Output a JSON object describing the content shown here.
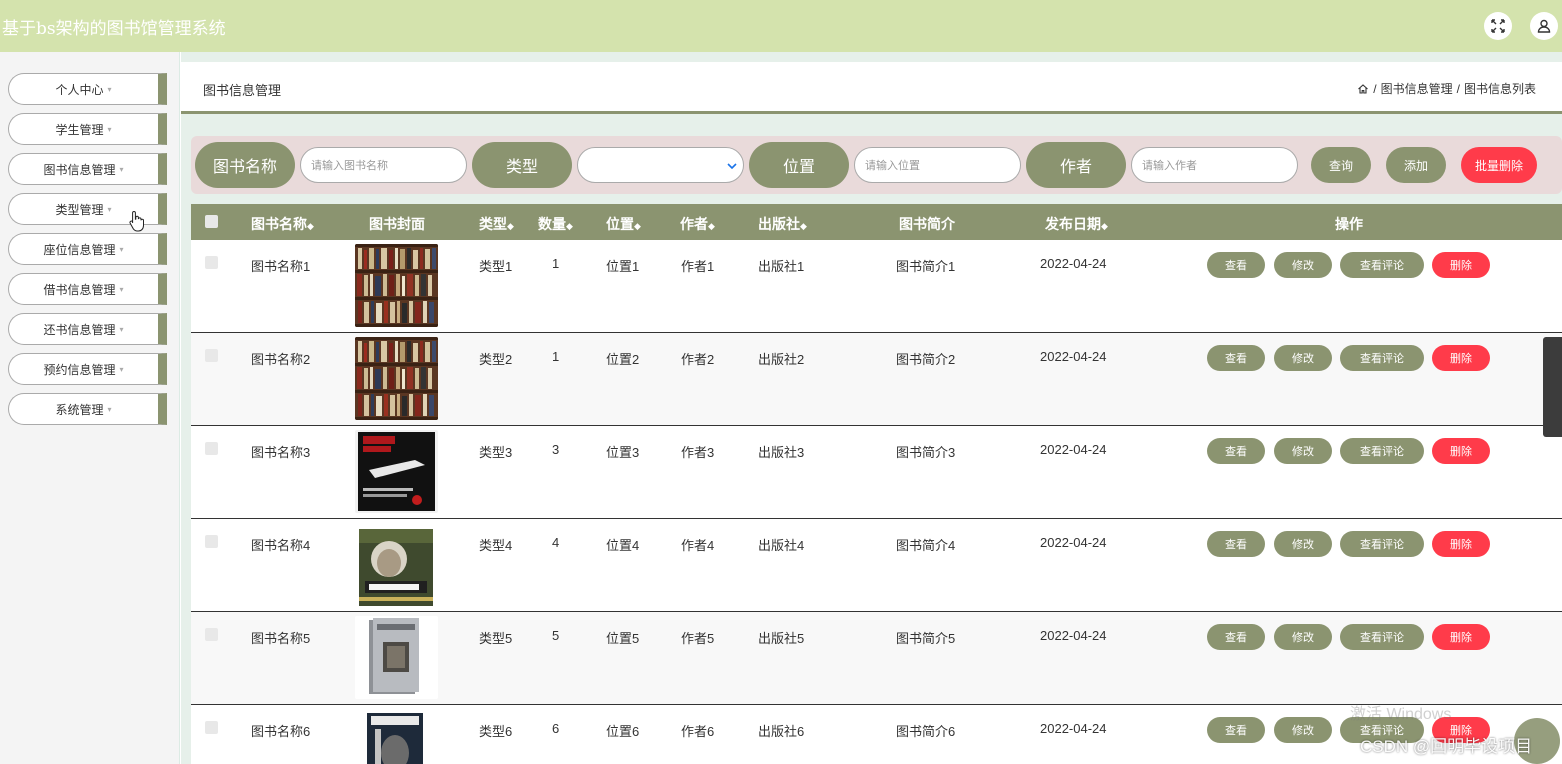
{
  "app": {
    "title": "基于bs架构的图书馆管理系统"
  },
  "header_icons": [
    "fullscreen-icon",
    "user-icon"
  ],
  "sidebar": {
    "items": [
      {
        "label": "个人中心",
        "caret": "▾"
      },
      {
        "label": "学生管理",
        "caret": "▾"
      },
      {
        "label": "图书信息管理",
        "caret": "▾"
      },
      {
        "label": "类型管理",
        "caret": "▾"
      },
      {
        "label": "座位信息管理",
        "caret": "▾"
      },
      {
        "label": "借书信息管理",
        "caret": "▾"
      },
      {
        "label": "还书信息管理",
        "caret": "▾"
      },
      {
        "label": "预约信息管理",
        "caret": "▾"
      },
      {
        "label": "系统管理",
        "caret": "▾"
      }
    ]
  },
  "page": {
    "title": "图书信息管理",
    "breadcrumb": [
      "/",
      "图书信息管理",
      "/",
      "图书信息列表"
    ]
  },
  "search": {
    "name_label": "图书名称",
    "name_placeholder": "请输入图书名称",
    "type_label": "类型",
    "type_value": "",
    "location_label": "位置",
    "location_placeholder": "请输入位置",
    "author_label": "作者",
    "author_placeholder": "请输入作者",
    "query_button": "查询",
    "add_button": "添加",
    "batch_delete_button": "批量删除"
  },
  "table": {
    "sort_glyph": "◆",
    "headers": {
      "name": "图书名称",
      "cover": "图书封面",
      "type": "类型",
      "quantity": "数量",
      "location": "位置",
      "author": "作者",
      "publisher": "出版社",
      "intro": "图书简介",
      "date": "发布日期",
      "actions": "操作"
    },
    "actions": {
      "view": "查看",
      "edit": "修改",
      "comments": "查看评论",
      "delete": "删除"
    },
    "rows": [
      {
        "name": "图书名称1",
        "type": "类型1",
        "quantity": "1",
        "location": "位置1",
        "author": "作者1",
        "publisher": "出版社1",
        "intro": "图书简介1",
        "date": "2022-04-24",
        "cover": "bookshelf"
      },
      {
        "name": "图书名称2",
        "type": "类型2",
        "quantity": "1",
        "location": "位置2",
        "author": "作者2",
        "publisher": "出版社2",
        "intro": "图书简介2",
        "date": "2022-04-24",
        "cover": "bookshelf"
      },
      {
        "name": "图书名称3",
        "type": "类型3",
        "quantity": "3",
        "location": "位置3",
        "author": "作者3",
        "publisher": "出版社3",
        "intro": "图书简介3",
        "date": "2022-04-24",
        "cover": "dark-book"
      },
      {
        "name": "图书名称4",
        "type": "类型4",
        "quantity": "4",
        "location": "位置4",
        "author": "作者4",
        "publisher": "出版社4",
        "intro": "图书简介4",
        "date": "2022-04-24",
        "cover": "portrait-book"
      },
      {
        "name": "图书名称5",
        "type": "类型5",
        "quantity": "5",
        "location": "位置5",
        "author": "作者5",
        "publisher": "出版社5",
        "intro": "图书简介5",
        "date": "2022-04-24",
        "cover": "grey-book"
      },
      {
        "name": "图书名称6",
        "type": "类型6",
        "quantity": "6",
        "location": "位置6",
        "author": "作者6",
        "publisher": "出版社6",
        "intro": "图书简介6",
        "date": "2022-04-24",
        "cover": "dark-portrait-book"
      }
    ]
  },
  "overlays": {
    "windows_watermark": "激活 Windows",
    "csdn_watermark": "CSDN @回明毕设项目"
  },
  "colors": {
    "topbar": "#d4e3ad",
    "accent": "#8b9470",
    "danger": "#ff3b4a",
    "search_bg": "#e9dada",
    "main_bg": "#e6f0ea"
  }
}
